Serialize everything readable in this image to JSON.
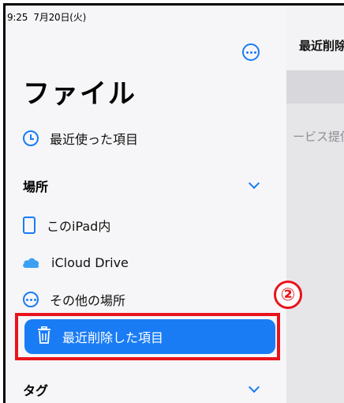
{
  "status_bar": {
    "time": "9:25",
    "date": "7月20日(火)"
  },
  "sidebar": {
    "title": "ファイル",
    "recents_label": "最近使った項目",
    "locations_header": "場所",
    "locations": [
      {
        "label": "このiPad内",
        "icon": "ipad-icon"
      },
      {
        "label": "iCloud Drive",
        "icon": "icloud-icon"
      },
      {
        "label": "その他の場所",
        "icon": "more-icon"
      },
      {
        "label": "最近削除した項目",
        "icon": "trash-icon",
        "selected": true
      }
    ],
    "tags_header": "タグ"
  },
  "main": {
    "title": "最近削除し",
    "info_text": "ービス提供"
  },
  "annotation": {
    "step_label": "②"
  },
  "colors": {
    "accent": "#1a7cf5",
    "highlight": "#e8141c",
    "sidebar_bg": "#f6f6f8"
  }
}
